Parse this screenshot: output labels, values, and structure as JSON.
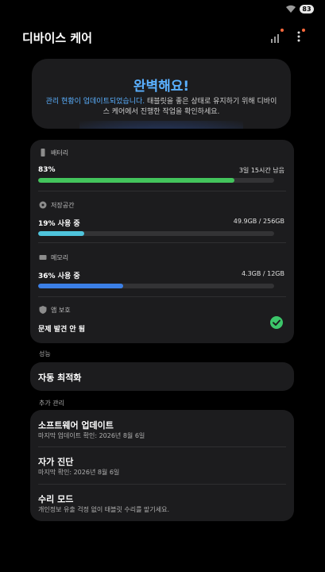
{
  "status_bar": {
    "battery": "83"
  },
  "header": {
    "title": "디바이스 케어"
  },
  "hero": {
    "title": "완벽해요!",
    "desc_highlight": "관리 현황이 업데이트되었습니다.",
    "desc_rest": " 태블릿을 좋은 상태로 유지하기 위해 디바이스 케어에서 진행한 작업을 확인하세요."
  },
  "status_card": {
    "battery": {
      "label": "배터리",
      "value": "83%",
      "meta": "3일 15시간 남음",
      "fill": 0.83,
      "color": "#43c45c"
    },
    "storage": {
      "label": "저장공간",
      "value": "19% 사용 중",
      "meta": "49.9GB / 256GB",
      "fill": 0.195,
      "color": "#4fc4dc"
    },
    "memory": {
      "label": "메모리",
      "value": "36% 사용 중",
      "meta": "4.3GB / 12GB",
      "fill": 0.36,
      "color": "#3b7fe6"
    },
    "app_protection": {
      "label": "앱 보호",
      "value": "문제 발견 안 됨"
    }
  },
  "performance": {
    "section": "성능",
    "auto_optimize": "자동 최적화"
  },
  "more": {
    "section": "추가 관리",
    "items": [
      {
        "title": "소프트웨어 업데이트",
        "sub": "마지막 업데이트 확인: 2026년 8월 6일"
      },
      {
        "title": "자가 진단",
        "sub": "마지막 확인: 2026년 8월 6일"
      },
      {
        "title": "수리 모드",
        "sub": "개인정보 유출 걱정 없이 태블릿 수리를 맡기세요."
      }
    ]
  }
}
